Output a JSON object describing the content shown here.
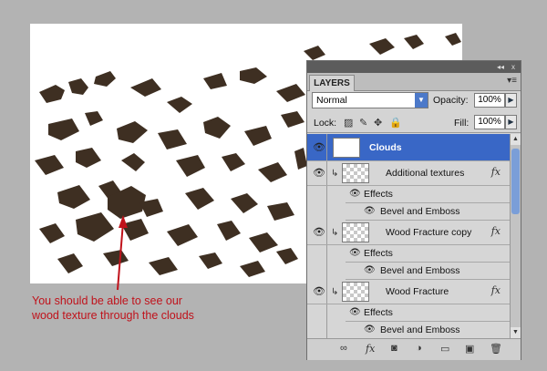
{
  "annotation": {
    "text": "You should be able to see our wood texture through the clouds",
    "color": "#c0121b"
  },
  "panel": {
    "tab_label": "LAYERS",
    "collapse_glyph": "◂◂",
    "close_glyph": "x",
    "menu_glyph": "▾≡",
    "blend_mode": "Normal",
    "opacity_label": "Opacity:",
    "opacity_value": "100%",
    "lock_label": "Lock:",
    "fill_label": "Fill:",
    "fill_value": "100%",
    "layers": [
      {
        "name": "Clouds",
        "selected": true
      },
      {
        "name": "Additional textures",
        "fx": "fx",
        "effects_label": "Effects",
        "effect": "Bevel and Emboss"
      },
      {
        "name": "Wood Fracture copy",
        "fx": "fx",
        "effects_label": "Effects",
        "effect": "Bevel and Emboss"
      },
      {
        "name": "Wood Fracture",
        "fx": "fx",
        "effects_label": "Effects",
        "effect": "Bevel and Emboss"
      }
    ],
    "bottom_icons": [
      "link-icon",
      "fx-icon",
      "mask-icon",
      "adjustment-icon",
      "folder-icon",
      "new-layer-icon",
      "trash-icon"
    ],
    "bottom_fx": "fx",
    "colors": {
      "selected": "#3967c6",
      "texture": "#3e2f22"
    }
  }
}
